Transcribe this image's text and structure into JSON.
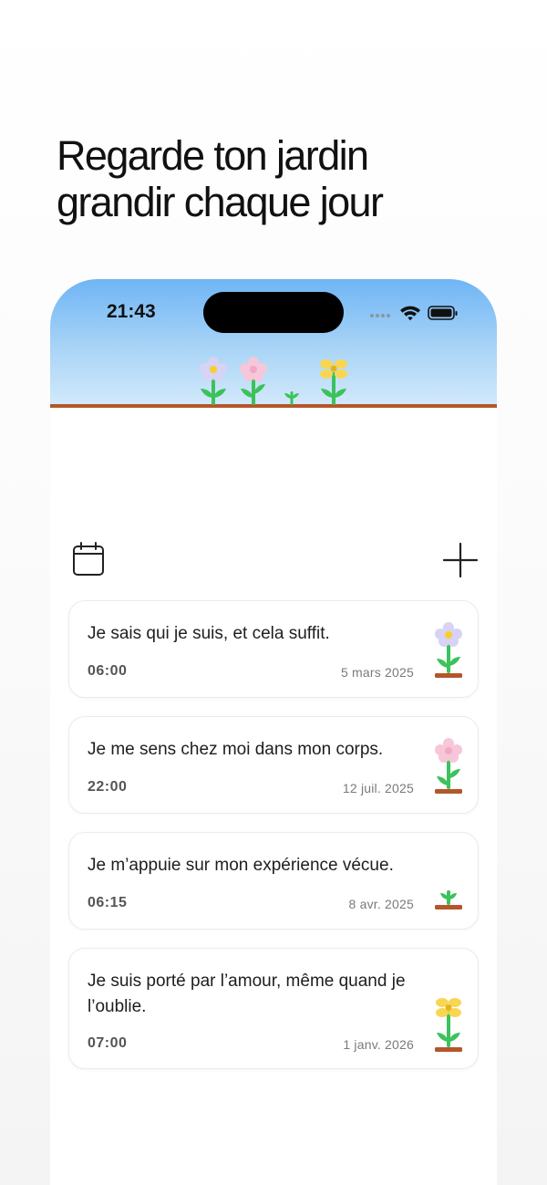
{
  "headline": {
    "line1": "Regarde ton jardin",
    "line2": "grandir chaque jour"
  },
  "status_bar": {
    "time": "21:43",
    "icons": [
      "signal-dots-icon",
      "wifi-icon",
      "battery-icon"
    ]
  },
  "garden": {
    "flowers": [
      "lavender-flower",
      "pink-flower",
      "sprout",
      "yellow-flower"
    ]
  },
  "toolbar": {
    "left_icon": "calendar-icon",
    "right_icon": "plus-icon"
  },
  "entries": [
    {
      "text": "Je sais qui je suis, et cela suffit.",
      "time": "06:00",
      "date": "5 mars 2025",
      "plant": "lavender-flower"
    },
    {
      "text": "Je me sens chez moi dans mon corps.",
      "time": "22:00",
      "date": "12 juil. 2025",
      "plant": "pink-flower"
    },
    {
      "text": "Je m’appuie sur mon expérience vécue.",
      "time": "06:15",
      "date": "8 avr. 2025",
      "plant": "sprout"
    },
    {
      "text": "Je suis porté par l’amour, même quand je l’oublie.",
      "time": "07:00",
      "date": "1 janv. 2026",
      "plant": "yellow-flower"
    }
  ],
  "colors": {
    "sky_top": "#6fb5f5",
    "sky_bottom": "#d2e9fb",
    "ground": "#b5562a",
    "stem": "#3cc25a",
    "lavender_petal": "#d8d2f5",
    "pink_petal": "#f7c6d8",
    "yellow_petal": "#f8d653",
    "flower_center": "#f6d126"
  }
}
